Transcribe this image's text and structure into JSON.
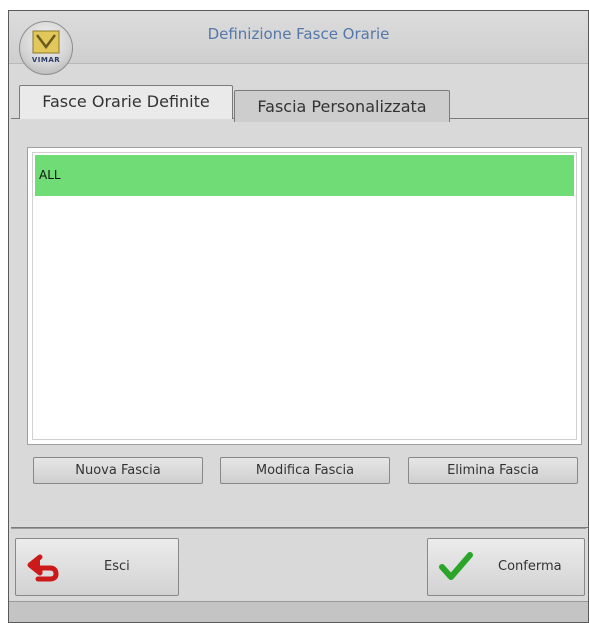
{
  "window": {
    "title": "Definizione Fasce Orarie",
    "logo_text": "VIMAR"
  },
  "tabs": [
    {
      "label": "Fasce Orarie Definite",
      "active": true
    },
    {
      "label": "Fascia Personalizzata",
      "active": false
    }
  ],
  "list": {
    "items": [
      {
        "label": "ALL",
        "selected": true
      }
    ],
    "selected_color": "#6fdc75"
  },
  "actions": {
    "new_label": "Nuova Fascia",
    "edit_label": "Modifica Fascia",
    "delete_label": "Elimina Fascia"
  },
  "footer": {
    "exit_label": "Esci",
    "exit_icon": "back-arrow-icon",
    "confirm_label": "Conferma",
    "confirm_icon": "checkmark-icon"
  },
  "colors": {
    "title_text": "#5577aa",
    "exit_icon": "#cc1a1a",
    "confirm_icon": "#2aa52a"
  }
}
